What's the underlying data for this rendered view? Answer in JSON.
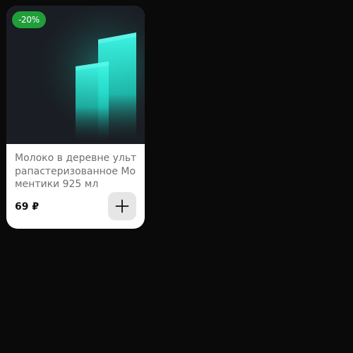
{
  "product_card": {
    "badge": "-20%",
    "title": "Молоко в деревне ультрапастеризованное Моментики 925 мл",
    "price": "69 ₽",
    "add_button_icon": "plus-icon",
    "image_placeholder_color": "#1a1d23",
    "badge_color": "#1f9e3a",
    "glow_color": "#27f0dc"
  }
}
